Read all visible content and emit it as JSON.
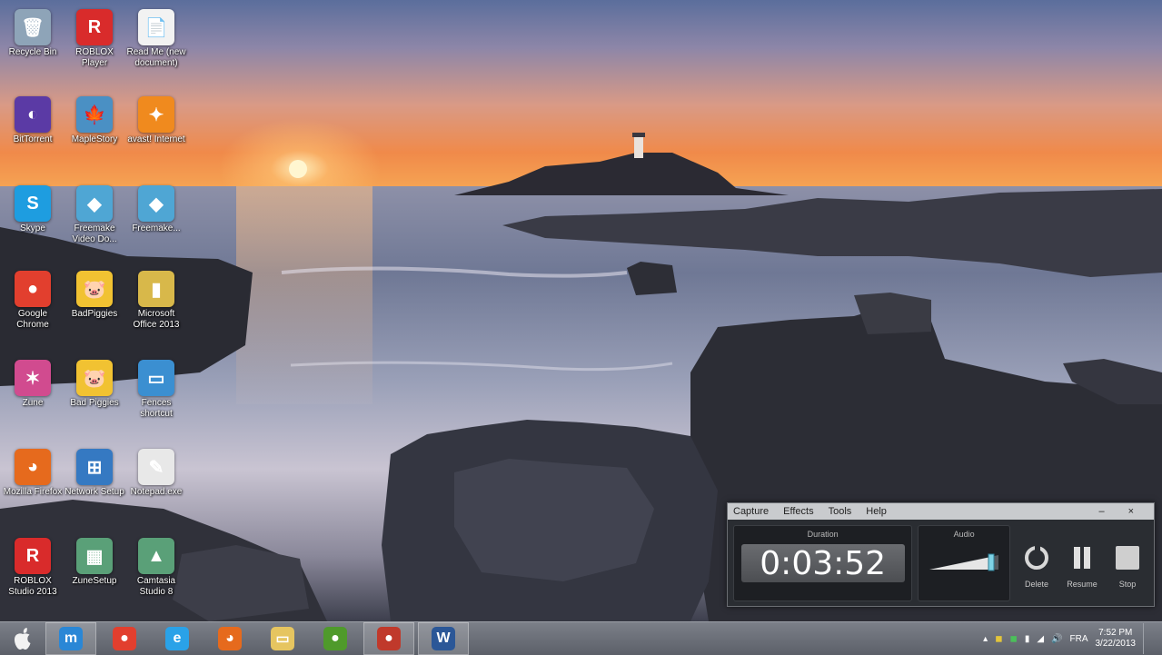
{
  "desktop": {
    "icons": [
      {
        "label": "Recycle Bin",
        "glyph": "🗑",
        "color": "#8ea4b8"
      },
      {
        "label": "ROBLOX Player",
        "glyph": "R",
        "color": "#d92b2b"
      },
      {
        "label": "Read Me (new document)",
        "glyph": "📄",
        "color": "#f2f2f2"
      },
      {
        "label": "BitTorrent",
        "glyph": "◐",
        "color": "#5b3aa5"
      },
      {
        "label": "MapleStory",
        "glyph": "🍁",
        "color": "#4a90c4"
      },
      {
        "label": "avast! Internet",
        "glyph": "✦",
        "color": "#f08a1e"
      },
      {
        "label": "Skype",
        "glyph": "S",
        "color": "#1e9de0"
      },
      {
        "label": "Freemake Video Do...",
        "glyph": "◆",
        "color": "#4fa6d4"
      },
      {
        "label": "Freemake...",
        "glyph": "◆",
        "color": "#4fa6d4"
      },
      {
        "label": "Google Chrome",
        "glyph": "●",
        "color": "#e23f2e"
      },
      {
        "label": "BadPiggies",
        "glyph": "🐷",
        "color": "#f1c232"
      },
      {
        "label": "Microsoft Office 2013",
        "glyph": "▮",
        "color": "#d8b84a"
      },
      {
        "label": "Zune",
        "glyph": "✶",
        "color": "#d14b8f"
      },
      {
        "label": "Bad Piggies",
        "glyph": "🐷",
        "color": "#f1c232"
      },
      {
        "label": "Fences shortcut",
        "glyph": "▭",
        "color": "#3b8fd1"
      },
      {
        "label": "Mozilla Firefox",
        "glyph": "◕",
        "color": "#e66a1d"
      },
      {
        "label": "Network Setup",
        "glyph": "⊞",
        "color": "#3579c2"
      },
      {
        "label": "Notepad.exe",
        "glyph": "✎",
        "color": "#e8e8e8"
      },
      {
        "label": "ROBLOX Studio 2013",
        "glyph": "R",
        "color": "#d92b2b"
      },
      {
        "label": "ZuneSetup",
        "glyph": "▦",
        "color": "#5aa078"
      },
      {
        "label": "Camtasia Studio 8",
        "glyph": "▲",
        "color": "#5aa078"
      }
    ]
  },
  "recorder": {
    "menu": [
      "Capture",
      "Effects",
      "Tools",
      "Help"
    ],
    "window_controls": [
      "–",
      "×"
    ],
    "duration_label": "Duration",
    "duration_value": "0:03:52",
    "audio_label": "Audio",
    "audio_level": 0.9,
    "buttons": [
      {
        "label": "Delete",
        "icon": "delete-icon"
      },
      {
        "label": "Resume",
        "icon": "pause-icon"
      },
      {
        "label": "Stop",
        "icon": "stop-icon"
      }
    ]
  },
  "taskbar": {
    "start_icon": "apple-logo-icon",
    "items": [
      {
        "name": "maxthon-browser",
        "glyph": "m",
        "color": "#2a87d6",
        "active": true
      },
      {
        "name": "google-chrome",
        "glyph": "●",
        "color": "#e23f2e",
        "active": false
      },
      {
        "name": "internet-explorer",
        "glyph": "e",
        "color": "#2aa2e8",
        "active": false
      },
      {
        "name": "mozilla-firefox",
        "glyph": "◕",
        "color": "#e66a1d",
        "active": false
      },
      {
        "name": "file-explorer",
        "glyph": "▭",
        "color": "#e6c560",
        "active": false
      },
      {
        "name": "bad-piggies-game",
        "glyph": "●",
        "color": "#4f9a2b",
        "active": false
      },
      {
        "name": "camtasia-recorder",
        "glyph": "●",
        "color": "#c0392b",
        "active": true
      },
      {
        "name": "microsoft-word",
        "glyph": "W",
        "color": "#2b5797",
        "active": true
      }
    ],
    "tray": {
      "language": "FRA",
      "time": "7:52 PM",
      "date": "3/22/2013"
    }
  },
  "colors": {
    "accent": "#2a87d6",
    "taskbar_bg": "#6b7079",
    "recorder_bg": "#2a2d32"
  }
}
